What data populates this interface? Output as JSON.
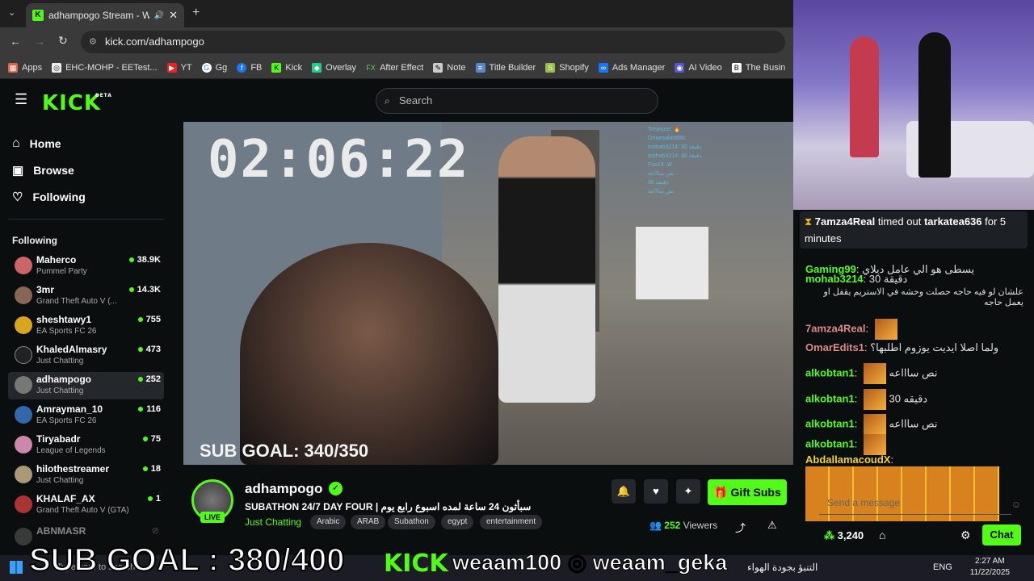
{
  "browser": {
    "tab_title": "adhampogo Stream - Watc",
    "url": "kick.com/adhampogo",
    "bookmarks": [
      "Apps",
      "EHC-MOHP - EETest...",
      "YT",
      "Gg",
      "FB",
      "Kick",
      "Overlay",
      "After Effect",
      "Note",
      "Title Builder",
      "Shopify",
      "Ads Manager",
      "AI Video",
      "The Busin"
    ]
  },
  "header": {
    "logo": "KICK",
    "beta": "BETA",
    "search_placeholder": "Search"
  },
  "sidebar": {
    "nav": [
      {
        "label": "Home"
      },
      {
        "label": "Browse"
      },
      {
        "label": "Following"
      }
    ],
    "following_header": "Following",
    "channels": [
      {
        "name": "Maherco",
        "game": "Pummel Party",
        "viewers": "38.9K"
      },
      {
        "name": "3mr",
        "game": "Grand Theft Auto V (...",
        "viewers": "14.3K"
      },
      {
        "name": "sheshtawy1",
        "game": "EA Sports FC 26",
        "viewers": "755"
      },
      {
        "name": "KhaledAlmasry",
        "game": "Just Chatting",
        "viewers": "473"
      },
      {
        "name": "adhampogo",
        "game": "Just Chatting",
        "viewers": "252"
      },
      {
        "name": "Amrayman_10",
        "game": "EA Sports FC 26",
        "viewers": "116"
      },
      {
        "name": "Tiryabadr",
        "game": "League of Legends",
        "viewers": "75"
      },
      {
        "name": "hilothestreamer",
        "game": "Just Chatting",
        "viewers": "18"
      },
      {
        "name": "KHALAF_AX",
        "game": "Grand Theft Auto V (GTA)",
        "viewers": "1"
      },
      {
        "name": "ABNMASR",
        "game": "",
        "viewers": ""
      }
    ]
  },
  "video": {
    "timer": "02:06:22",
    "sub_goal": "SUB GOAL: 340/350",
    "overlay_chat": [
      "Treasure: 🔥",
      "Omarsalah888:",
      "mohab3214: 30 دقيقة",
      "mohab3214: 30 دقيقة",
      "Fox19: W",
      "نص ساااعة",
      "دقيقة 30",
      "نص ساااعة"
    ]
  },
  "stream": {
    "name": "adhampogo",
    "live": "LIVE",
    "title": "SUBATHON 24/7 DAY FOUR | سبأثون 24 ساعة لمده اسبوع رابع يوم",
    "category": "Just Chatting",
    "tags": [
      "Arabic",
      "ARAB",
      "Subathon",
      "egypt",
      "entertainment"
    ],
    "gift_subs": "Gift Subs",
    "viewers_count": "252",
    "viewers_label": "Viewers"
  },
  "chat": {
    "pinned_user": "7amza4Real",
    "pinned_text": "timed out",
    "pinned_target": "tarkatea636",
    "pinned_suffix": "for 5 minutes",
    "messages": [
      {
        "user": "Gaming99",
        "text": "يسطى هو الي عامل ديلاي"
      },
      {
        "user": "mohab3214",
        "text": "دقيقة 30"
      },
      {
        "user": "",
        "text": "علشان لو فيه حاجه حصلت وحشه في الاستريم يقفل او يعمل حاجه"
      },
      {
        "user": "7amza4Real",
        "text": ""
      },
      {
        "user": "OmarEdits1",
        "text": "ولما اصلا ايديت يوزوم اطلبها؟"
      },
      {
        "user": "alkobtan1",
        "text": "نص ساااعه"
      },
      {
        "user": "alkobtan1",
        "text": "دقيقه 30"
      },
      {
        "user": "alkobtan1",
        "text": "نص ساااعه"
      },
      {
        "user": "alkobtan1",
        "text": ""
      },
      {
        "user": "AbdallamacoudX",
        "text": ""
      }
    ],
    "send_placeholder": "Send a message",
    "points": "3,240",
    "chat_button": "Chat"
  },
  "overlay": {
    "sub_goal_big": "SUB GOAL : 380/400",
    "kick": "KICK",
    "social": "weaam100 ◎ weaam_geka"
  },
  "taskbar": {
    "search": "Type here to search",
    "weather": "التنبؤ بجودة الهواء",
    "lang": "ENG",
    "time": "2:27 AM",
    "date": "11/22/2025"
  }
}
